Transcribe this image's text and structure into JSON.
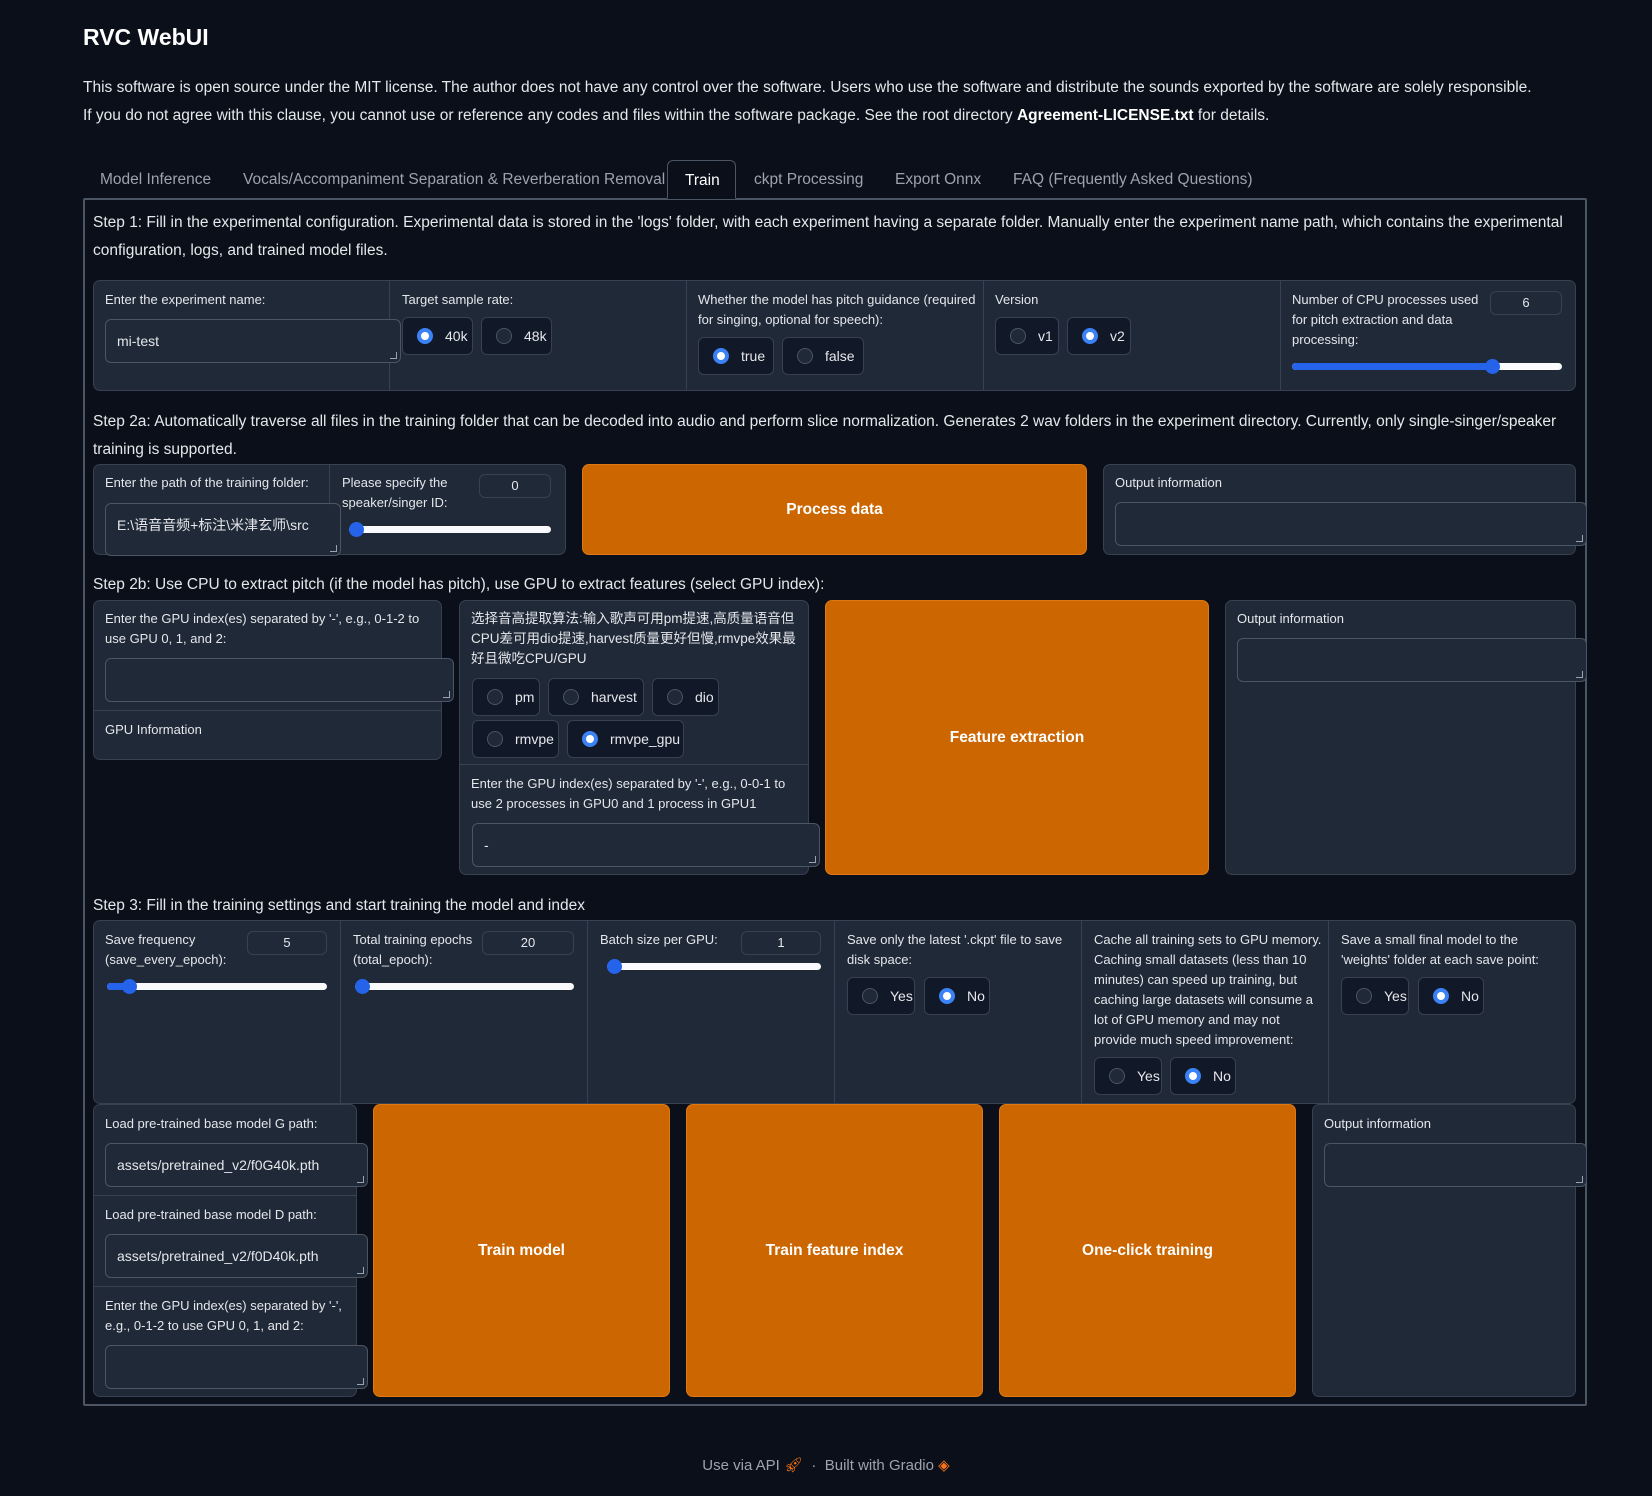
{
  "app": {
    "title": "RVC WebUI",
    "license_line1": "This software is open source under the MIT license. The author does not have any control over the software. Users who use the software and distribute the sounds exported by the software are solely responsible.",
    "license_line2_a": "If you do not agree with this clause, you cannot use or reference any codes and files within the software package. See the root directory ",
    "license_line2_b": "Agreement-LICENSE.txt",
    "license_line2_c": " for details."
  },
  "tabs": [
    {
      "label": "Model Inference"
    },
    {
      "label": "Vocals/Accompaniment Separation & Reverberation Removal"
    },
    {
      "label": "Train"
    },
    {
      "label": "ckpt Processing"
    },
    {
      "label": "Export Onnx"
    },
    {
      "label": "FAQ (Frequently Asked Questions)"
    }
  ],
  "step1": {
    "text": "Step 1: Fill in the experimental configuration. Experimental data is stored in the 'logs' folder, with each experiment having a separate folder. Manually enter the experiment name path, which contains the experimental configuration, logs, and trained model files.",
    "exp_name_label": "Enter the experiment name:",
    "exp_name_value": "mi-test",
    "sample_rate_label": "Target sample rate:",
    "sample_rate_options": [
      "40k",
      "48k"
    ],
    "sample_rate_selected": "40k",
    "pitch_label": "Whether the model has pitch guidance (required for singing, optional for speech):",
    "pitch_options": [
      "true",
      "false"
    ],
    "pitch_selected": "true",
    "version_label": "Version",
    "version_options": [
      "v1",
      "v2"
    ],
    "version_selected": "v2",
    "cpu_label": "Number of CPU processes used for pitch extraction and data processing:",
    "cpu_value": "6",
    "cpu_slider_fraction": 0.74
  },
  "step2a": {
    "text": "Step 2a: Automatically traverse all files in the training folder that can be decoded into audio and perform slice normalization. Generates 2 wav folders in the experiment directory. Currently, only single-singer/speaker training is supported.",
    "folder_label": "Enter the path of the training folder:",
    "folder_value": "E:\\语音音频+标注\\米津玄师\\src",
    "speaker_label": "Please specify the speaker/singer ID:",
    "speaker_value": "0",
    "speaker_slider_fraction": 0.0,
    "process_button": "Process data",
    "output_label": "Output information",
    "output_value": ""
  },
  "step2b": {
    "text": "Step 2b: Use CPU to extract pitch (if the model has pitch), use GPU to extract features (select GPU index):",
    "gpu_label": "Enter the GPU index(es) separated by '-', e.g., 0-1-2 to use GPU 0, 1, and 2:",
    "gpu_value": "",
    "gpu_info_label": "GPU Information",
    "algo_label": "选择音高提取算法:输入歌声可用pm提速,高质量语音但CPU差可用dio提速,harvest质量更好但慢,rmvpe效果最好且微吃CPU/GPU",
    "algo_options": [
      "pm",
      "harvest",
      "dio",
      "rmvpe",
      "rmvpe_gpu"
    ],
    "algo_selected": "rmvpe_gpu",
    "rmvpe_gpu_label": "Enter the GPU index(es) separated by '-', e.g., 0-0-1 to use 2 processes in GPU0 and 1 process in GPU1",
    "rmvpe_gpu_value": "-",
    "extract_button": "Feature extraction",
    "output_label": "Output information",
    "output_value": ""
  },
  "step3": {
    "text": "Step 3: Fill in the training settings and start training the model and index",
    "save_freq_label": "Save frequency (save_every_epoch):",
    "save_freq_value": "5",
    "save_freq_fraction": 0.1,
    "epochs_label": "Total training epochs (total_epoch):",
    "epochs_value": "20",
    "epochs_fraction": 0.0,
    "batch_label": "Batch size per GPU:",
    "batch_value": "1",
    "batch_fraction": 0.0,
    "latest_label": "Save only the latest '.ckpt' file to save disk space:",
    "latest_options": [
      "Yes",
      "No"
    ],
    "latest_selected": "No",
    "cache_label": "Cache all training sets to GPU memory. Caching small datasets (less than 10 minutes) can speed up training, but caching large datasets will consume a lot of GPU memory and may not provide much speed improvement:",
    "cache_options": [
      "Yes",
      "No"
    ],
    "cache_selected": "No",
    "weights_label": "Save a small final model to the 'weights' folder at each save point:",
    "weights_options": [
      "Yes",
      "No"
    ],
    "weights_selected": "No",
    "g_path_label": "Load pre-trained base model G path:",
    "g_path_value": "assets/pretrained_v2/f0G40k.pth",
    "d_path_label": "Load pre-trained base model D path:",
    "d_path_value": "assets/pretrained_v2/f0D40k.pth",
    "gpus_label": "Enter the GPU index(es) separated by '-', e.g., 0-1-2 to use GPU 0, 1, and 2:",
    "gpus_value": "",
    "train_button": "Train model",
    "index_button": "Train feature index",
    "oneclick_button": "One-click training",
    "output_label": "Output information",
    "output_value": ""
  },
  "footer": {
    "api": "Use via API",
    "sep": "·",
    "built": "Built with Gradio"
  },
  "colors": {
    "background": "#0b0f19",
    "panel": "#1f2937",
    "accent_orange": "#cc6600",
    "accent_blue": "#2563eb"
  }
}
